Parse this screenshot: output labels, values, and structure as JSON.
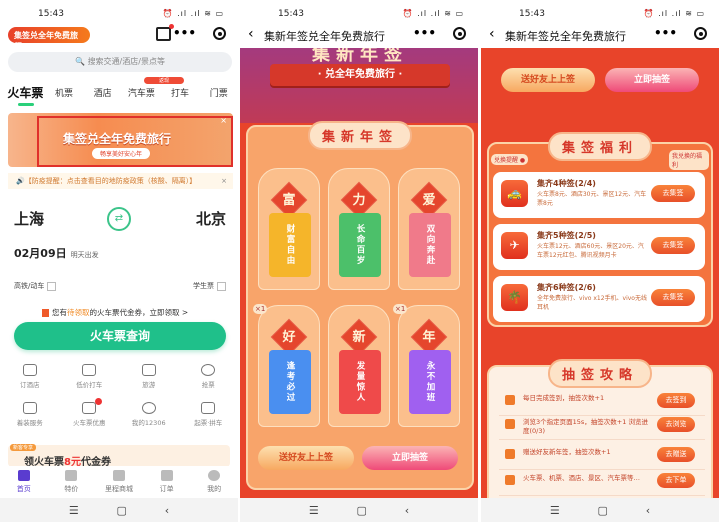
{
  "status": {
    "time": "15:43",
    "icons": "⏰ .ıl .ıl ≋ ▭"
  },
  "screen1": {
    "logo": "集签兑全年免费旅行",
    "search_placeholder": "搜索交通/酒店/景点等",
    "tabs": [
      {
        "label": "火车票"
      },
      {
        "label": "机票"
      },
      {
        "label": "酒店"
      },
      {
        "label": "汽车票",
        "badge": "返现"
      },
      {
        "label": "打车"
      },
      {
        "label": "门票"
      }
    ],
    "banner": {
      "title": "集签兑全年免费旅行",
      "subtitle": "畅享美好安心年",
      "close": "×"
    },
    "notice": {
      "text": "🔊【防疫提醒：点击查看目的地防疫政策（核酸、隔离）】",
      "close": "×"
    },
    "from": "上海",
    "to": "北京",
    "date": "02月09日",
    "date_note": "明天出发",
    "high_speed": "高铁/动车",
    "student": "学生票",
    "coupon": {
      "prefix": "您有",
      "highlight": "待领取",
      "suffix": "的火车票代金券，立即领取 >"
    },
    "search_button": "火车票查询",
    "services": [
      {
        "label": "订酒店",
        "icon": "hotel-icon"
      },
      {
        "label": "低价打车",
        "icon": "car-icon"
      },
      {
        "label": "旅游",
        "icon": "palm-icon"
      },
      {
        "label": "抢票",
        "icon": "timer-icon"
      },
      {
        "label": "着装服务",
        "icon": "service-icon"
      },
      {
        "label": "火车票优惠",
        "icon": "ticket-icon"
      },
      {
        "label": "我的12306",
        "icon": "train-icon"
      },
      {
        "label": "起票·拼车",
        "icon": "carpool-icon"
      }
    ],
    "promo": {
      "tag": "新客专享",
      "prefix": "领火车票",
      "amount": "8元",
      "suffix": "代金券"
    },
    "bottom_nav": [
      {
        "label": "首页"
      },
      {
        "label": "特价"
      },
      {
        "label": "里程商城"
      },
      {
        "label": "订单"
      },
      {
        "label": "我的"
      }
    ]
  },
  "screen2": {
    "title": "集新年签兑全年免费旅行",
    "hero_big": "集新年签",
    "hero_ribbon": "· 兑全年免费旅行 ·",
    "section": "集新年签",
    "cards": [
      {
        "char": "富",
        "text": "财富自由",
        "color": "#f5b52a"
      },
      {
        "char": "力",
        "text": "长命百岁",
        "color": "#4cc06a"
      },
      {
        "char": "爱",
        "text": "双向奔赴",
        "color": "#f07a8a"
      },
      {
        "char": "好",
        "text": "逢考必过",
        "color": "#4a8ff0",
        "count": "×1"
      },
      {
        "char": "新",
        "text": "发量惊人",
        "color": "#ef4a4a"
      },
      {
        "char": "年",
        "text": "永不加班",
        "color": "#a060f0",
        "count": "×1"
      }
    ],
    "btn_send": "送好友上上签",
    "btn_draw": "立即抽签"
  },
  "screen3": {
    "title": "集新年签兑全年免费旅行",
    "btn_send": "送好友上上签",
    "btn_draw": "立即抽签",
    "benefits": {
      "section": "集签福利",
      "toggle": "兑换提醒",
      "my": "我兑换的福利",
      "items": [
        {
          "title": "集齐4种签(2/4)",
          "desc": "火车票8元、酒店30元、景区12元、汽车票8元",
          "button": "去集签"
        },
        {
          "title": "集齐5种签(2/5)",
          "desc": "火车票12元、酒店60元、景区20元、汽车票12元红包、腾讯视频月卡",
          "button": "去集签"
        },
        {
          "title": "集齐6种签(2/6)",
          "desc": "全年免费旅行、vivo x12手机、vivo无线耳机",
          "button": "去集签"
        }
      ]
    },
    "strategy": {
      "section": "抽签攻略",
      "tasks": [
        {
          "text": "每日完成签到，抽签次数+1",
          "button": "去签到"
        },
        {
          "text": "浏览3个指定页面15s，抽签次数+1 浏览进度(0/3)",
          "button": "去浏览"
        },
        {
          "text": "赠送好友新年签，抽签次数+1",
          "button": "去赠送"
        },
        {
          "text": "火车票、机票、酒店、景区、汽车票等…",
          "button": "去下单"
        }
      ]
    }
  },
  "sysnav": {
    "menu": "☰",
    "home": "▢",
    "back": "‹"
  }
}
